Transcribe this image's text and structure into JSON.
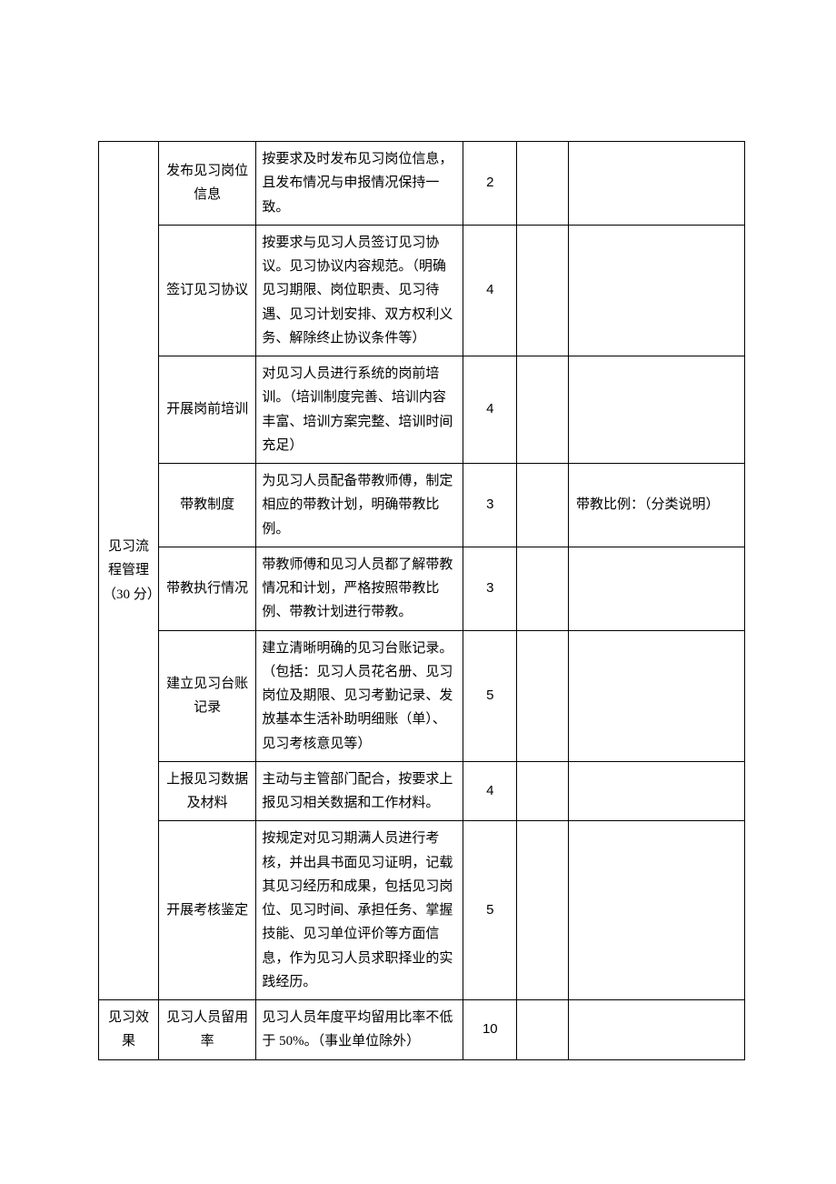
{
  "categories": [
    {
      "name": "见习流程管理（30 分）",
      "rows": [
        {
          "item": "发布见习岗位信息",
          "desc": "按要求及时发布见习岗位信息，且发布情况与申报情况保持一致。",
          "score": "2",
          "note": ""
        },
        {
          "item": "签订见习协议",
          "desc": "按要求与见习人员签订见习协议。见习协议内容规范。（明确见习期限、岗位职责、见习待遇、见习计划安排、双方权利义务、解除终止协议条件等）",
          "score": "4",
          "note": ""
        },
        {
          "item": "开展岗前培训",
          "desc": "对见习人员进行系统的岗前培训。（培训制度完善、培训内容丰富、培训方案完整、培训时间充足）",
          "score": "4",
          "note": ""
        },
        {
          "item": "带教制度",
          "desc": "为见习人员配备带教师傅，制定相应的带教计划，明确带教比例。",
          "score": "3",
          "note": "带教比例：（分类说明）"
        },
        {
          "item": "带教执行情况",
          "desc": "带教师傅和见习人员都了解带教情况和计划，严格按照带教比例、带教计划进行带教。",
          "score": "3",
          "note": ""
        },
        {
          "item": "建立见习台账记录",
          "desc": "建立清晰明确的见习台账记录。（包括：见习人员花名册、见习岗位及期限、见习考勤记录、发放基本生活补助明细账（单）、见习考核意见等）",
          "score": "5",
          "note": ""
        },
        {
          "item": "上报见习数据及材料",
          "desc": "主动与主管部门配合，按要求上报见习相关数据和工作材料。",
          "score": "4",
          "note": ""
        },
        {
          "item": "开展考核鉴定",
          "desc": "按规定对见习期满人员进行考核，并出具书面见习证明，记载其见习经历和成果，包括见习岗位、见习时间、承担任务、掌握技能、见习单位评价等方面信息，作为见习人员求职择业的实践经历。",
          "score": "5",
          "note": ""
        }
      ]
    },
    {
      "name": "见习效果",
      "rows": [
        {
          "item": "见习人员留用率",
          "desc": "见习人员年度平均留用比率不低于 50%。（事业单位除外）",
          "score": "10",
          "note": ""
        }
      ]
    }
  ]
}
